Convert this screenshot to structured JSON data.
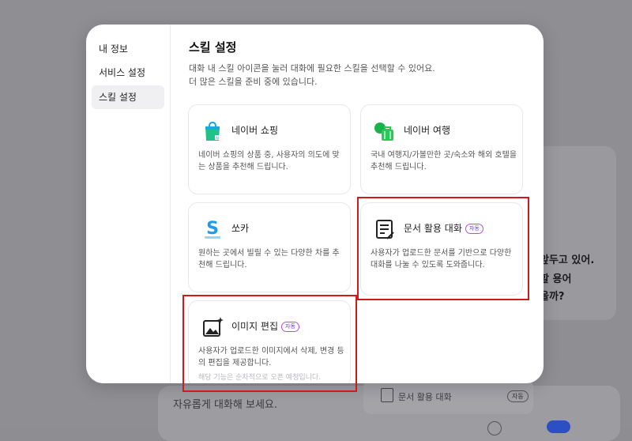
{
  "background": {
    "right_lines": [
      "앞두고 있어.",
      "할 용어",
      "을까?"
    ],
    "input_placeholder": "자유롭게 대화해 보세요.",
    "chip_label": "문서 활용 대화",
    "chip_badge": "자동"
  },
  "modal": {
    "nav": [
      {
        "label": "내 정보",
        "active": false
      },
      {
        "label": "서비스 설정",
        "active": false
      },
      {
        "label": "스킬 설정",
        "active": true
      }
    ],
    "title": "스킬 설정",
    "description_lines": [
      "대화 내 스킬 아이콘을 눌러 대화에 필요한 스킬을 선택할 수 있어요.",
      "더 많은 스킬을 준비 중에 있습니다."
    ],
    "close_label": "×",
    "cards": [
      {
        "name": "네이버 쇼핑",
        "icon": "shopping-bag-icon",
        "desc": "네이버 쇼핑의 상품 중, 사용자의 의도에 맞는 상품을 추천해 드립니다."
      },
      {
        "name": "네이버 여행",
        "icon": "travel-suitcase-icon",
        "desc": "국내 여행지/가볼만한 곳/숙소와 해외 호텔을 추천해 드립니다."
      },
      {
        "name": "쏘카",
        "icon": "socar-logo-icon",
        "desc": "원하는 곳에서 빌릴 수 있는 다양한 차를 추천해 드립니다."
      },
      {
        "name": "문서 활용 대화",
        "icon": "document-edit-icon",
        "badge": "자동",
        "desc": "사용자가 업로드한 문서를 기반으로 다양한 대화를 나눌 수 있도록 도와줍니다."
      },
      {
        "name": "이미지 편집",
        "icon": "image-edit-icon",
        "badge": "자동",
        "desc": "사용자가 업로드한 이미지에서 삭제, 변경 등의 편집을 제공합니다.",
        "note": "해당 기능은 순차적으로 오픈 예정입니다."
      }
    ]
  },
  "colors": {
    "highlight": "#d11a1a",
    "badge": "#6d3bd6",
    "shopping": "#1fc38a",
    "travel": "#19b24b",
    "socar": "#1e9bf0"
  }
}
